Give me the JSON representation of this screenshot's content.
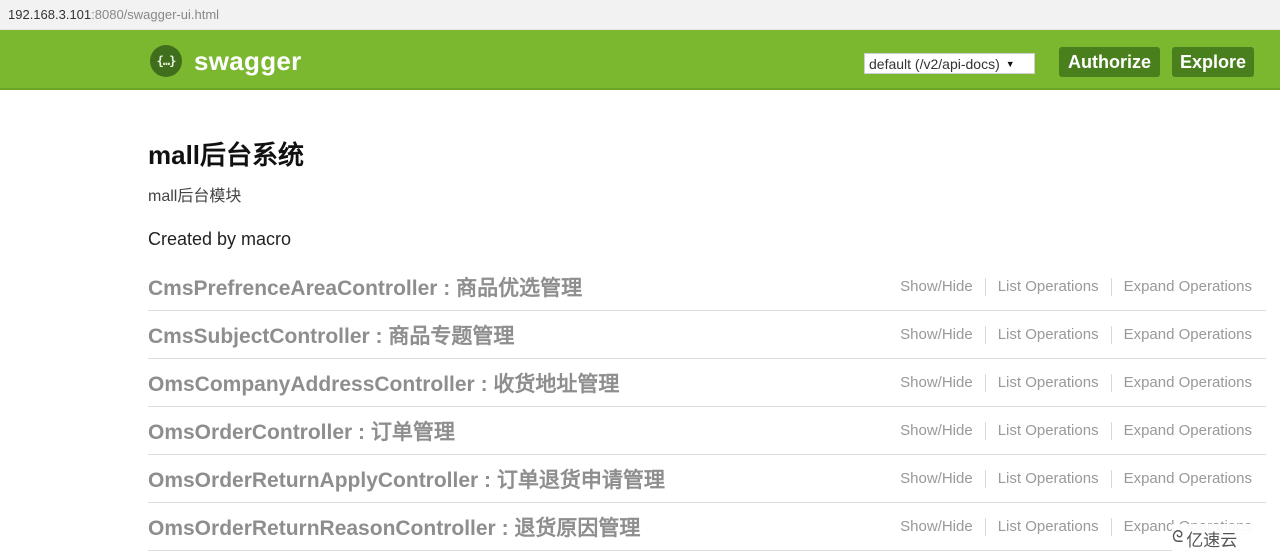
{
  "browser": {
    "url_host": "192.168.3.101",
    "url_rest": ":8080/swagger-ui.html"
  },
  "header": {
    "logo_icon": "{…}",
    "logo_text": "swagger",
    "spec_select_value": "default (/v2/api-docs)",
    "spec_select_arrow": "▼",
    "authorize_label": "Authorize",
    "explore_label": "Explore",
    "colors": {
      "bar": "#7cb82f",
      "button": "#4a7f1e"
    }
  },
  "info": {
    "title": "mall后台系统",
    "description": "mall后台模块",
    "created_by": "Created by macro"
  },
  "ops_labels": {
    "show_hide": "Show/Hide",
    "list_operations": "List Operations",
    "expand_operations": "Expand Operations"
  },
  "resources": [
    {
      "title": "CmsPrefrenceAreaController : 商品优选管理"
    },
    {
      "title": "CmsSubjectController : 商品专题管理"
    },
    {
      "title": "OmsCompanyAddressController : 收货地址管理"
    },
    {
      "title": "OmsOrderController : 订单管理"
    },
    {
      "title": "OmsOrderReturnApplyController : 订单退货申请管理"
    },
    {
      "title": "OmsOrderReturnReasonController : 退货原因管理"
    }
  ],
  "watermark": {
    "icon": "cloud-logo-icon",
    "glyph": "ᘓ",
    "text": "亿速云"
  }
}
